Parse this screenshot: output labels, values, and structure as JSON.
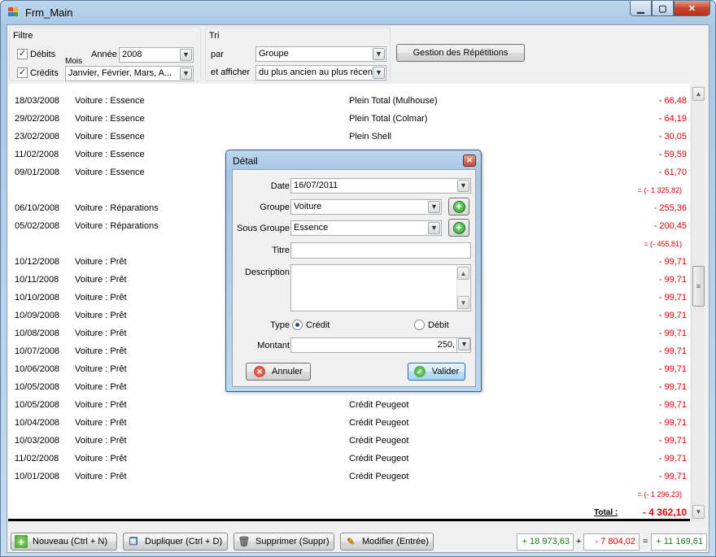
{
  "window": {
    "title": "Frm_Main"
  },
  "filter": {
    "title": "Filtre",
    "debits_label": "Débits",
    "credits_label": "Crédits",
    "mois_label": "Mois",
    "annee_label": "Année",
    "annee_value": "2008",
    "mois_value": "Janvier, Février, Mars, A..."
  },
  "tri": {
    "title": "Tri",
    "par_label": "par",
    "par_value": "Groupe",
    "afficher_label": "et afficher",
    "afficher_value": "du plus ancien au plus récent"
  },
  "gestion_button": "Gestion des Répétitions",
  "rows": [
    {
      "date": "18/03/2008",
      "group": "Voiture : Essence",
      "title": "Plein Total (Mulhouse)",
      "amount": "- 66,48"
    },
    {
      "date": "29/02/2008",
      "group": "Voiture : Essence",
      "title": "Plein Total (Colmar)",
      "amount": "- 64,19"
    },
    {
      "date": "23/02/2008",
      "group": "Voiture : Essence",
      "title": "Plein Shell",
      "amount": "- 30,05"
    },
    {
      "date": "11/02/2008",
      "group": "Voiture : Essence",
      "title": "",
      "amount": "- 59,59"
    },
    {
      "date": "09/01/2008",
      "group": "Voiture : Essence",
      "title": "",
      "amount": "- 61,70"
    },
    {
      "date": "",
      "group": "",
      "title": "",
      "amount": "",
      "subtotal": "= (- 1 325,82)"
    },
    {
      "date": "06/10/2008",
      "group": "Voiture : Réparations",
      "title": "",
      "amount": "- 255,36"
    },
    {
      "date": "05/02/2008",
      "group": "Voiture : Réparations",
      "title": "",
      "amount": "- 200,45"
    },
    {
      "date": "",
      "group": "",
      "title": "",
      "amount": "",
      "subtotal": "= (- 455,81)"
    },
    {
      "date": "10/12/2008",
      "group": "Voiture : Prêt",
      "title": "",
      "amount": "- 99,71"
    },
    {
      "date": "10/11/2008",
      "group": "Voiture : Prêt",
      "title": "",
      "amount": "- 99,71"
    },
    {
      "date": "10/10/2008",
      "group": "Voiture : Prêt",
      "title": "",
      "amount": "- 99,71"
    },
    {
      "date": "10/09/2008",
      "group": "Voiture : Prêt",
      "title": "",
      "amount": "- 99,71"
    },
    {
      "date": "10/08/2008",
      "group": "Voiture : Prêt",
      "title": "",
      "amount": "- 99,71"
    },
    {
      "date": "10/07/2008",
      "group": "Voiture : Prêt",
      "title": "",
      "amount": "- 99,71"
    },
    {
      "date": "10/06/2008",
      "group": "Voiture : Prêt",
      "title": "",
      "amount": "- 99,71"
    },
    {
      "date": "10/05/2008",
      "group": "Voiture : Prêt",
      "title": "",
      "amount": "- 99,71"
    },
    {
      "date": "10/05/2008",
      "group": "Voiture : Prêt",
      "title": "Crédit Peugeot",
      "amount": "- 99,71"
    },
    {
      "date": "10/04/2008",
      "group": "Voiture : Prêt",
      "title": "Crédit Peugeot",
      "amount": "- 99,71"
    },
    {
      "date": "10/03/2008",
      "group": "Voiture : Prêt",
      "title": "Crédit Peugeot",
      "amount": "- 99,71"
    },
    {
      "date": "11/02/2008",
      "group": "Voiture : Prêt",
      "title": "Crédit Peugeot",
      "amount": "- 99,71"
    },
    {
      "date": "10/01/2008",
      "group": "Voiture : Prêt",
      "title": "Crédit Peugeot",
      "amount": "- 99,71"
    },
    {
      "date": "",
      "group": "",
      "title": "",
      "amount": "",
      "subtotal": "= (- 1 296,23)"
    }
  ],
  "total": {
    "label": "Total :",
    "value": "- 4 362,10"
  },
  "toolbar": {
    "nouveau": "Nouveau (Ctrl + N)",
    "dupliquer": "Dupliquer (Ctrl + D)",
    "supprimer": "Supprimer (Suppr)",
    "modifier": "Modifier (Entrée)",
    "sum_credit": "+ 18 973,63",
    "op_plus": "+",
    "sum_debit": "- 7 804,02",
    "op_eq": "=",
    "sum_total": "+ 11 169,61"
  },
  "dialog": {
    "title": "Détail",
    "date_label": "Date",
    "date_value": "16/07/2011",
    "groupe_label": "Groupe",
    "groupe_value": "Voiture",
    "sous_groupe_label": "Sous Groupe",
    "sous_groupe_value": "Essence",
    "titre_label": "Titre",
    "titre_value": "",
    "description_label": "Description",
    "type_label": "Type",
    "credit_label": "Crédit",
    "debit_label": "Débit",
    "montant_label": "Montant",
    "montant_value": "250,",
    "annuler": "Annuler",
    "valider": "Valider"
  },
  "colors": {
    "negative": "#e00000",
    "positive": "#1a7a1a"
  }
}
